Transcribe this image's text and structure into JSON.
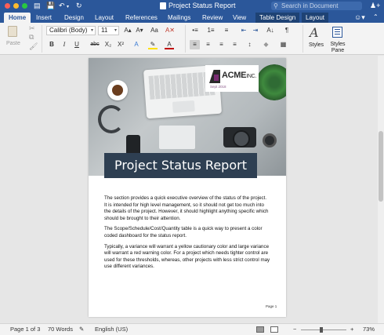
{
  "window": {
    "title": "Project Status Report",
    "search_placeholder": "Search in Document"
  },
  "tabs": [
    {
      "label": "Home",
      "active": true
    },
    {
      "label": "Insert"
    },
    {
      "label": "Design"
    },
    {
      "label": "Layout"
    },
    {
      "label": "References"
    },
    {
      "label": "Mailings"
    },
    {
      "label": "Review"
    },
    {
      "label": "View"
    },
    {
      "label": "Table Design",
      "contextual": true
    },
    {
      "label": "Layout",
      "contextual": true
    }
  ],
  "ribbon": {
    "paste_label": "Paste",
    "font_name": "Calibri (Body)",
    "font_size": "11",
    "grow_font": "A▴",
    "shrink_font": "A▾",
    "change_case": "Aa",
    "clear_format": "A✕",
    "bold": "B",
    "italic": "I",
    "underline": "U",
    "strikethrough": "abc",
    "subscript": "X₂",
    "superscript": "X²",
    "text_effects": "A",
    "highlight": "✎",
    "font_color": "A",
    "bullets": "•≡",
    "numbering": "1≡",
    "multilevel": "≡",
    "decrease_indent": "⇤",
    "increase_indent": "⇥",
    "sort": "A↓",
    "show_marks": "¶",
    "align_left": "≡",
    "align_center": "≡",
    "align_right": "≡",
    "justify": "≡",
    "line_spacing": "↕",
    "shading": "◆",
    "borders": "▦",
    "styles_label": "Styles",
    "styles_pane_label": "Styles Pane"
  },
  "document": {
    "logo_name": "ACME",
    "logo_suffix": "INC.",
    "logo_date": "Sept 2018",
    "title": "Project Status Report",
    "paragraphs": [
      "The section provides a quick executive overview of the status of the project. It is intended for high level management, so it should not get too much into the details of the project. However, it should highlight anything specific which should be brought to their attention.",
      "The Scope/Schedule/Cost/Quantity table is a quick way to present a color coded dashboard for the status report.",
      "Typically, a variance will warrant a yellow cautionary color and large variance will warrant a red warning color. For a project which needs tighter control are used for these thresholds, whereas, other projects with less strict control may use different variances."
    ],
    "page_number": "Page 1"
  },
  "status_bar": {
    "page": "Page 1 of 3",
    "words": "70 Words",
    "language": "English (US)",
    "zoom_minus": "−",
    "zoom_plus": "+",
    "zoom": "73%"
  },
  "colors": {
    "accent": "#2b579a",
    "banner": "#2e3f52",
    "logo_accent": "#7a2d73"
  }
}
